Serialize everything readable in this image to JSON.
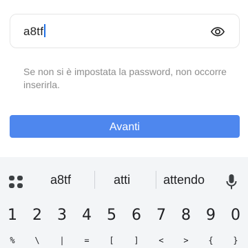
{
  "password_field": {
    "value": "a8tf"
  },
  "hint_text": "Se non si è impostata la password, non occorre inserirla.",
  "avanti_label": "Avanti",
  "keyboard": {
    "suggestions": [
      "a8tf",
      "atti",
      "attendo"
    ],
    "numbers": [
      "1",
      "2",
      "3",
      "4",
      "5",
      "6",
      "7",
      "8",
      "9",
      "0"
    ],
    "symbols": [
      "%",
      "\\",
      "|",
      "=",
      "[",
      "]",
      "<",
      ">",
      "{",
      "}"
    ]
  },
  "colors": {
    "accent": "#4e87ee",
    "hint": "#8c8c8c",
    "keyboard_bg": "#f3f5f7"
  },
  "icons": {
    "visibility": "eye-icon",
    "grid": "apps-grid-icon",
    "voice": "microphone-icon"
  }
}
